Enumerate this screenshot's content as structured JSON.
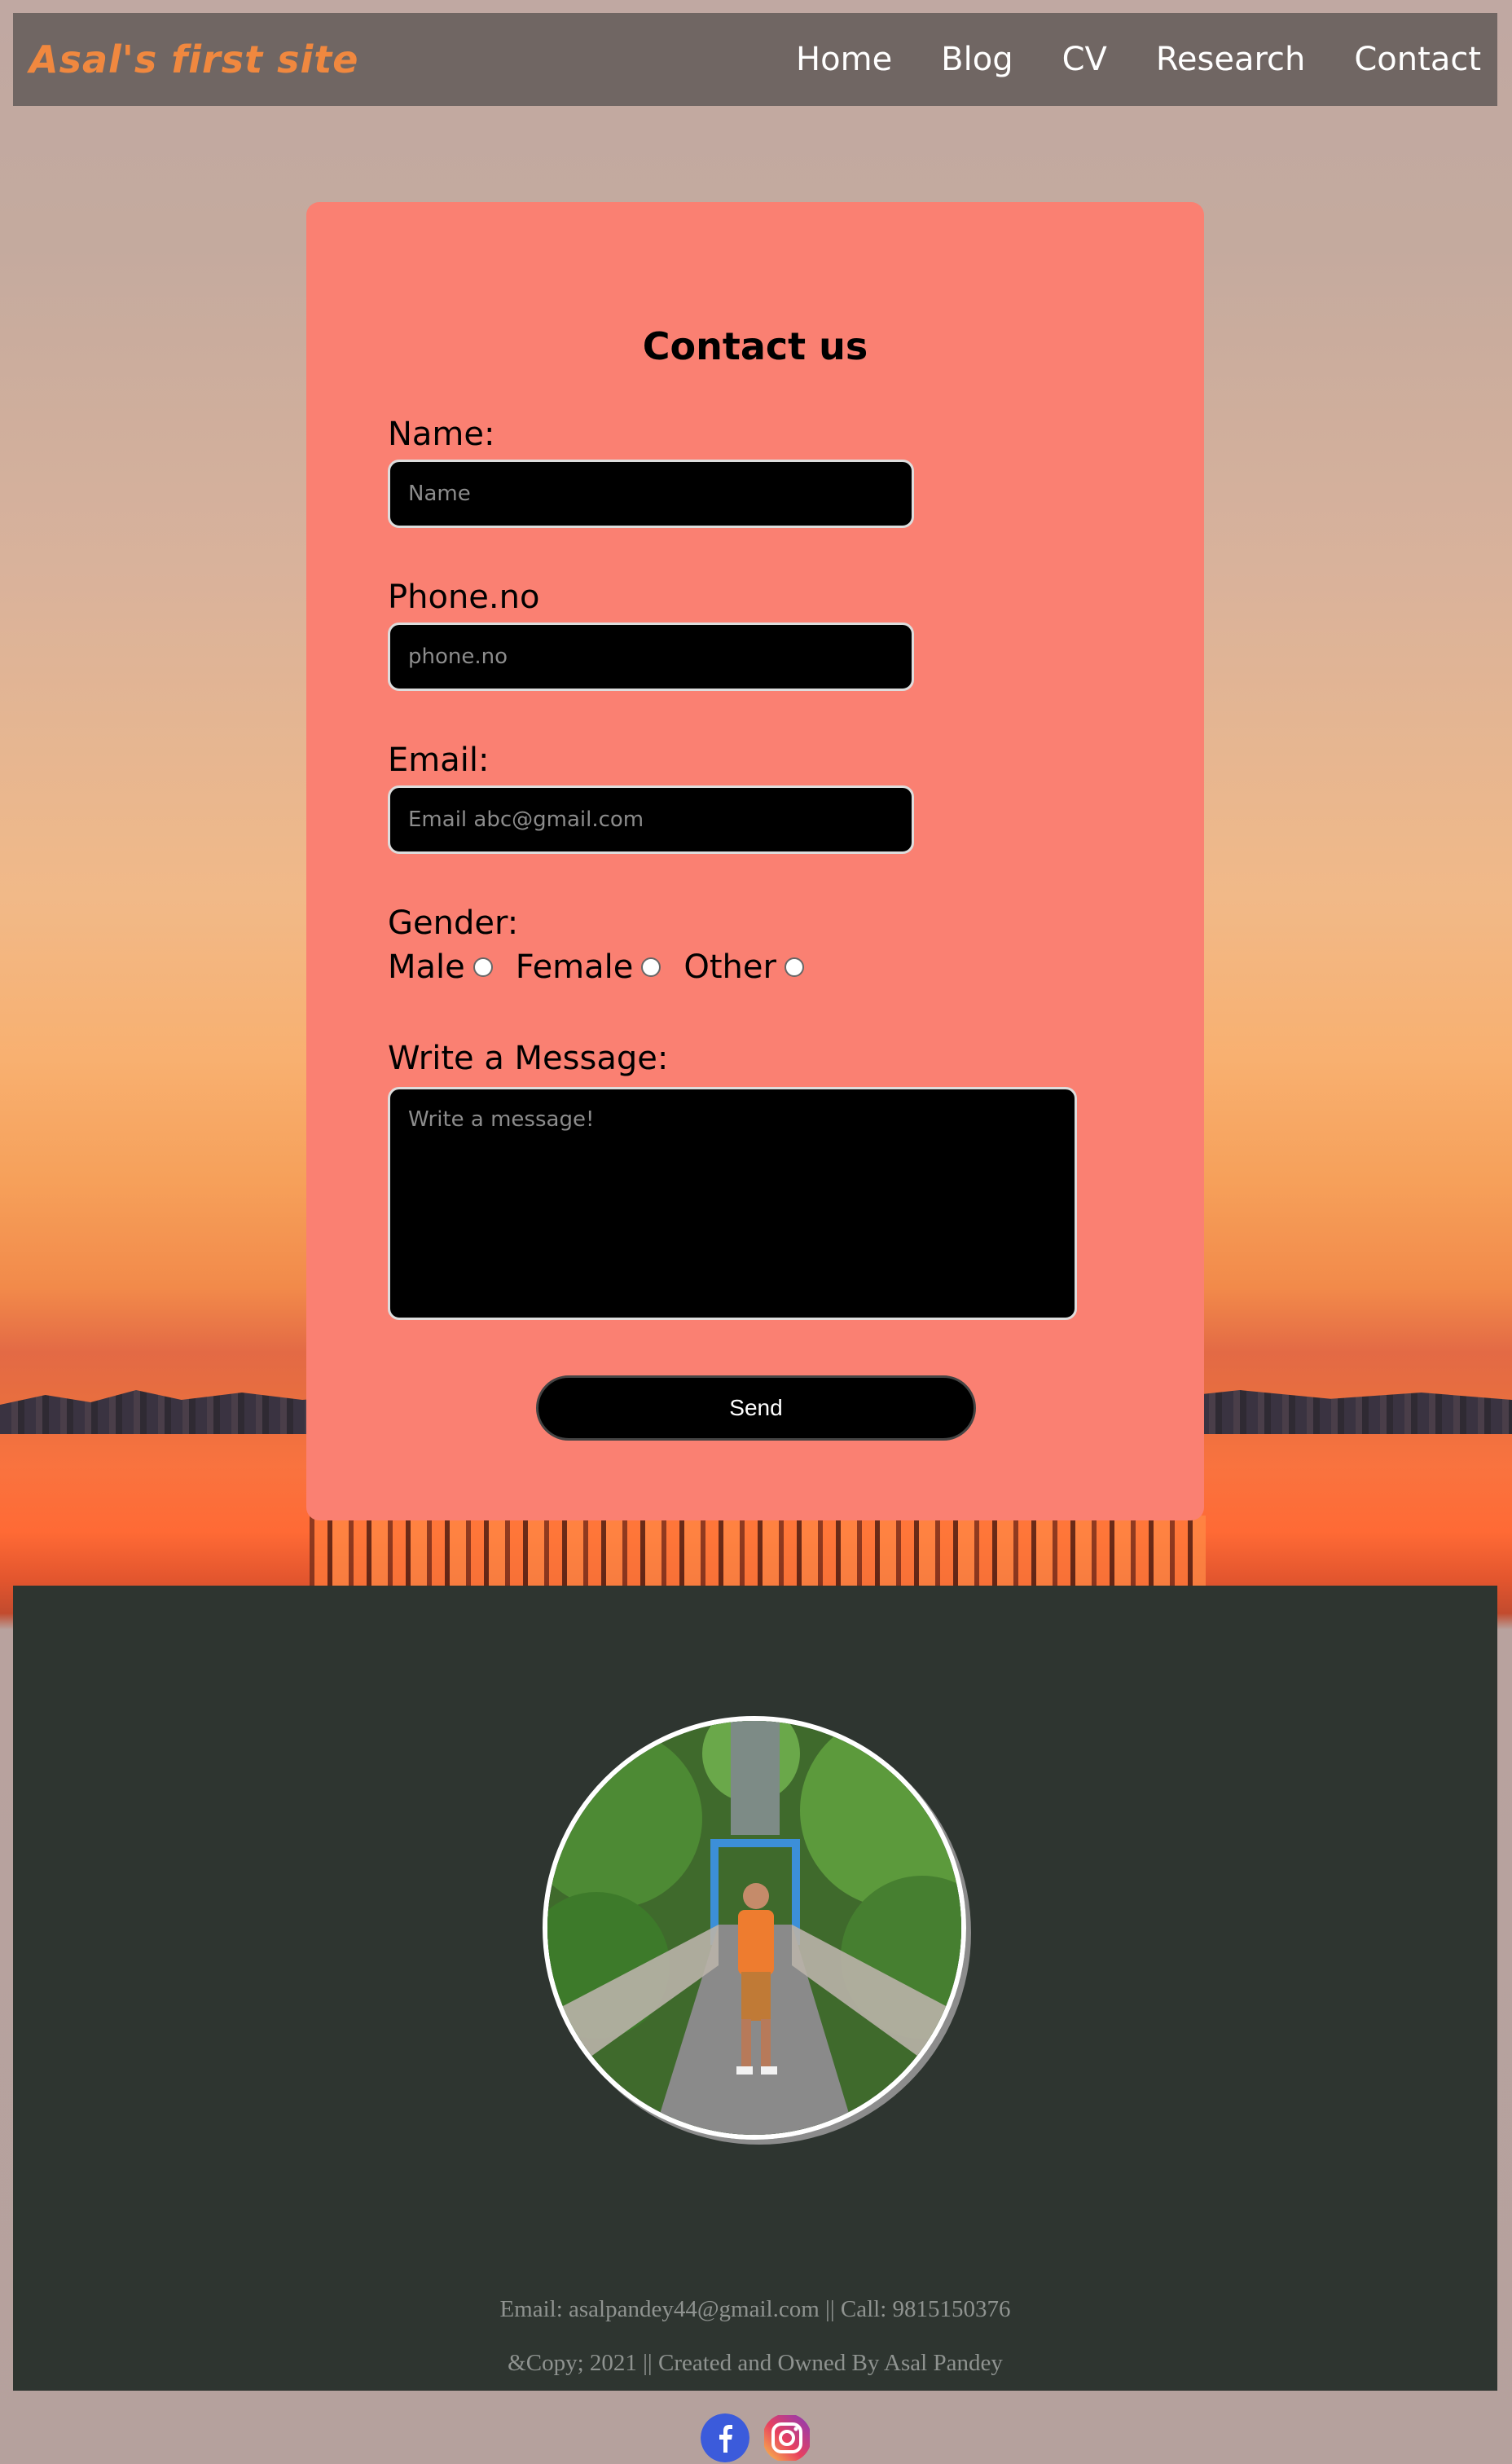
{
  "site": {
    "brand": "Asal's first site",
    "nav": [
      "Home",
      "Blog",
      "CV",
      "Research",
      "Contact"
    ]
  },
  "form": {
    "title": "Contact us",
    "name_label": "Name:",
    "name_placeholder": "Name",
    "phone_label": "Phone.no",
    "phone_placeholder": "phone.no",
    "email_label": "Email:",
    "email_placeholder": "Email abc@gmail.com",
    "gender_label": "Gender:",
    "gender_options": [
      "Male",
      "Female",
      "Other"
    ],
    "message_label": "Write a Message:",
    "message_placeholder": "Write a message!",
    "send_label": "Send"
  },
  "footer": {
    "contact": "Email: asalpandey44@gmail.com || Call: 9815150376",
    "copyright": "&Copy; 2021 || Created and Owned By Asal Pandey"
  },
  "social": [
    "facebook-icon",
    "instagram-icon"
  ],
  "colors": {
    "navbar": "#706663",
    "brand": "#f0883f",
    "card": "#fa8072",
    "footer": "#2e3530"
  }
}
